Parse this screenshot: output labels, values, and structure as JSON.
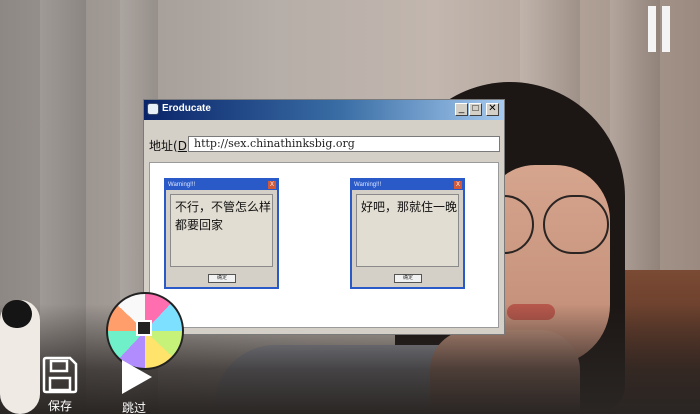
{
  "window": {
    "title": "Eroducate",
    "address_label": "地址",
    "address_shortcut": "D",
    "url": "http://sex.chinathinksbig.org",
    "minimize": "_",
    "maximize": "□",
    "close": "✕"
  },
  "choices": [
    {
      "title": "Warning!!!",
      "message": "不行，不管怎么样都要回家",
      "close": "X",
      "ok": "确定"
    },
    {
      "title": "Warning!!!",
      "message": "好吧，那就住一晚",
      "close": "X",
      "ok": "确定"
    }
  ],
  "hud": {
    "save_label": "保存",
    "skip_label": "跳过",
    "pause_icon": "pause-icon",
    "save_icon": "floppy-disk-icon",
    "skip_icon": "play-triangle-icon"
  },
  "colors": {
    "titlebar_dark": "#0a246a",
    "titlebar_light": "#a6caf0",
    "dialog_border": "#2a5ac8",
    "window_face": "#d4d0c8"
  }
}
